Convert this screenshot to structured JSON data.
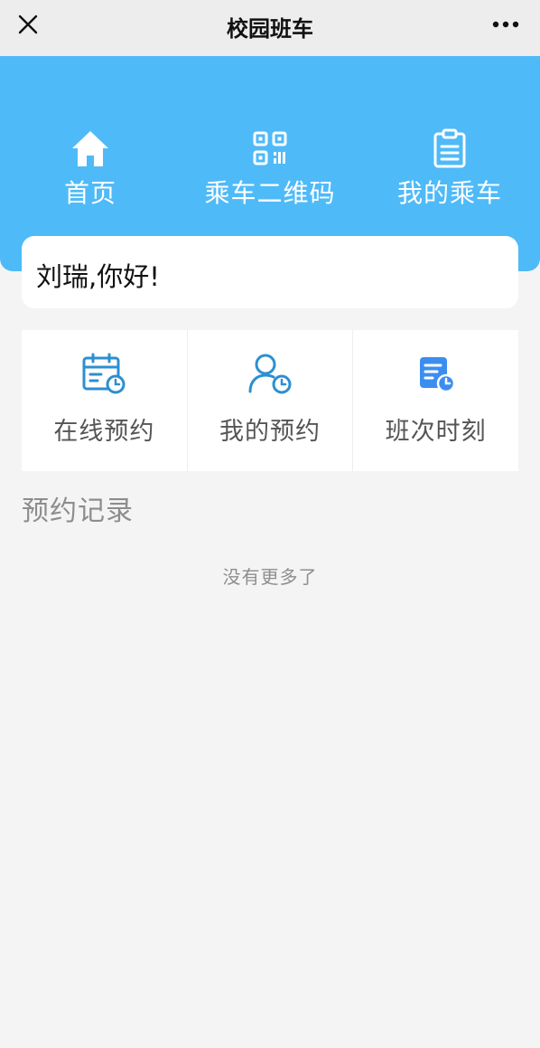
{
  "titlebar": {
    "title": "校园班车",
    "close_icon": "close-icon",
    "more_icon": "more-dots-icon"
  },
  "colors": {
    "header_blue": "#4fbaf8",
    "action_icon_blue": "#2c8fd0",
    "schedule_icon_blue": "#3b8ef0"
  },
  "nav": {
    "items": [
      {
        "label": "首页",
        "icon": "home-icon"
      },
      {
        "label": "乘车二维码",
        "icon": "qr-code-icon"
      },
      {
        "label": "我的乘车",
        "icon": "clipboard-icon"
      }
    ]
  },
  "greeting": "刘瑞,你好!",
  "actions": [
    {
      "label": "在线预约",
      "icon": "calendar-clock-icon"
    },
    {
      "label": "我的预约",
      "icon": "user-clock-icon"
    },
    {
      "label": "班次时刻",
      "icon": "document-clock-icon"
    }
  ],
  "records": {
    "section_title": "预约记录",
    "empty_text": "没有更多了"
  }
}
